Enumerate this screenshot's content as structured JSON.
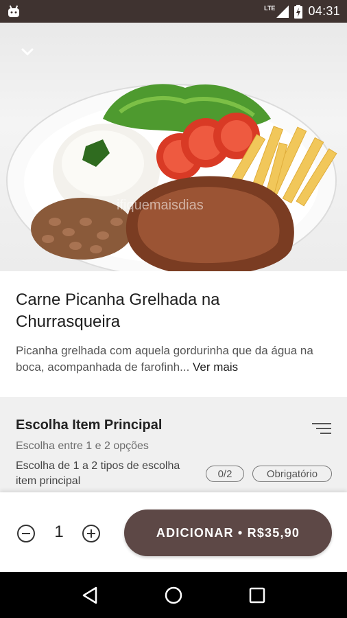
{
  "status_bar": {
    "time": "04:31",
    "network": "LTE",
    "icons": [
      "android-icon",
      "signal-icon",
      "battery-charging-icon"
    ]
  },
  "hero": {
    "back_icon": "chevron-down-icon",
    "watermark": "ifiquemaisdias"
  },
  "product": {
    "title": "Carne Picanha Grelhada na Churrasqueira",
    "description": "Picanha grelhada com aquela gordurinha que da água na boca, acompanhada de farofinh...",
    "see_more": "Ver mais"
  },
  "section": {
    "title": "Escolha Item Principal",
    "subtitle": "Escolha entre 1 e 2 opções",
    "note": "Escolha de 1 a 2 tipos de escolha item principal",
    "count_badge": "0/2",
    "required_badge": "Obrigatório",
    "icon": "filter-icon"
  },
  "action_bar": {
    "quantity": "1",
    "add_label": "ADICIONAR • R$35,90",
    "colors": {
      "button": "#5d4846"
    }
  },
  "nav_bar": {
    "icons": [
      "back-triangle-icon",
      "home-circle-icon",
      "recents-square-icon"
    ]
  }
}
